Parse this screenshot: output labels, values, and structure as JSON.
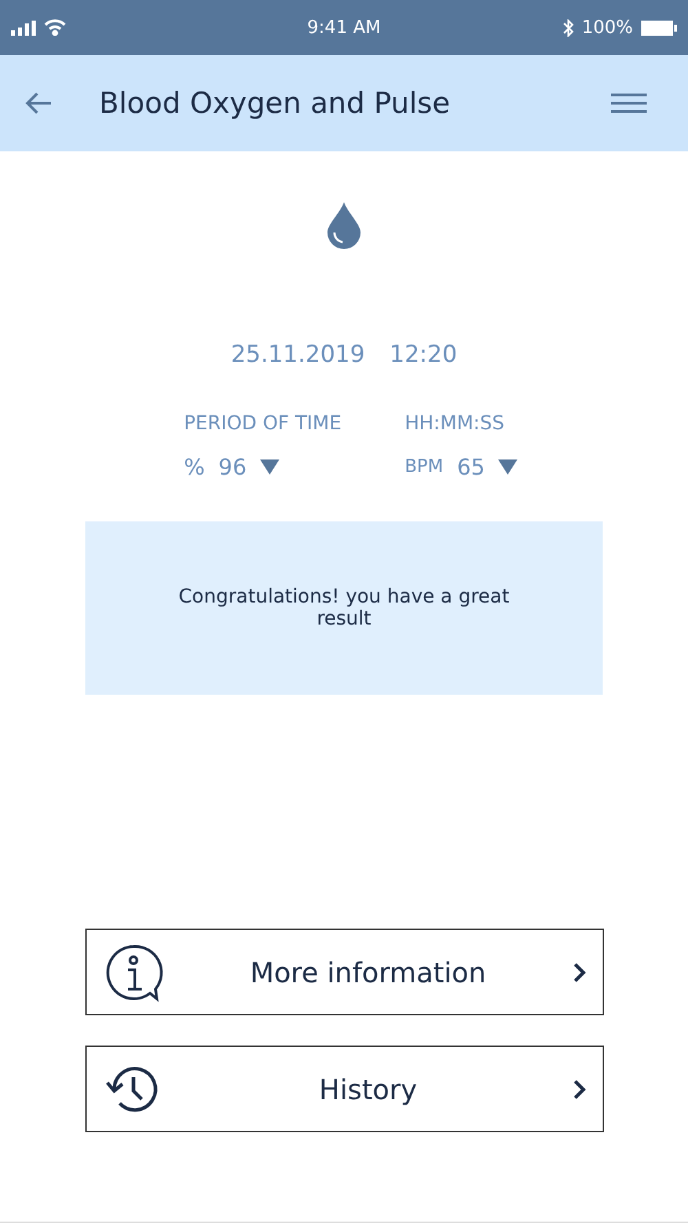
{
  "status_bar": {
    "time": "9:41 AM",
    "battery": "100%"
  },
  "header": {
    "title": "Blood Oxygen and Pulse"
  },
  "reading": {
    "date": "25.11.2019",
    "time": "12:20"
  },
  "columns": [
    {
      "label": "PERIOD OF TIME",
      "unit": "%",
      "value": "96"
    },
    {
      "label": "HH:MM:SS",
      "unit": "BPM",
      "value": "65"
    }
  ],
  "message": "Congratulations! you have a great result",
  "buttons": [
    {
      "kind": "info",
      "label": "More information"
    },
    {
      "kind": "history",
      "label": "History"
    }
  ]
}
